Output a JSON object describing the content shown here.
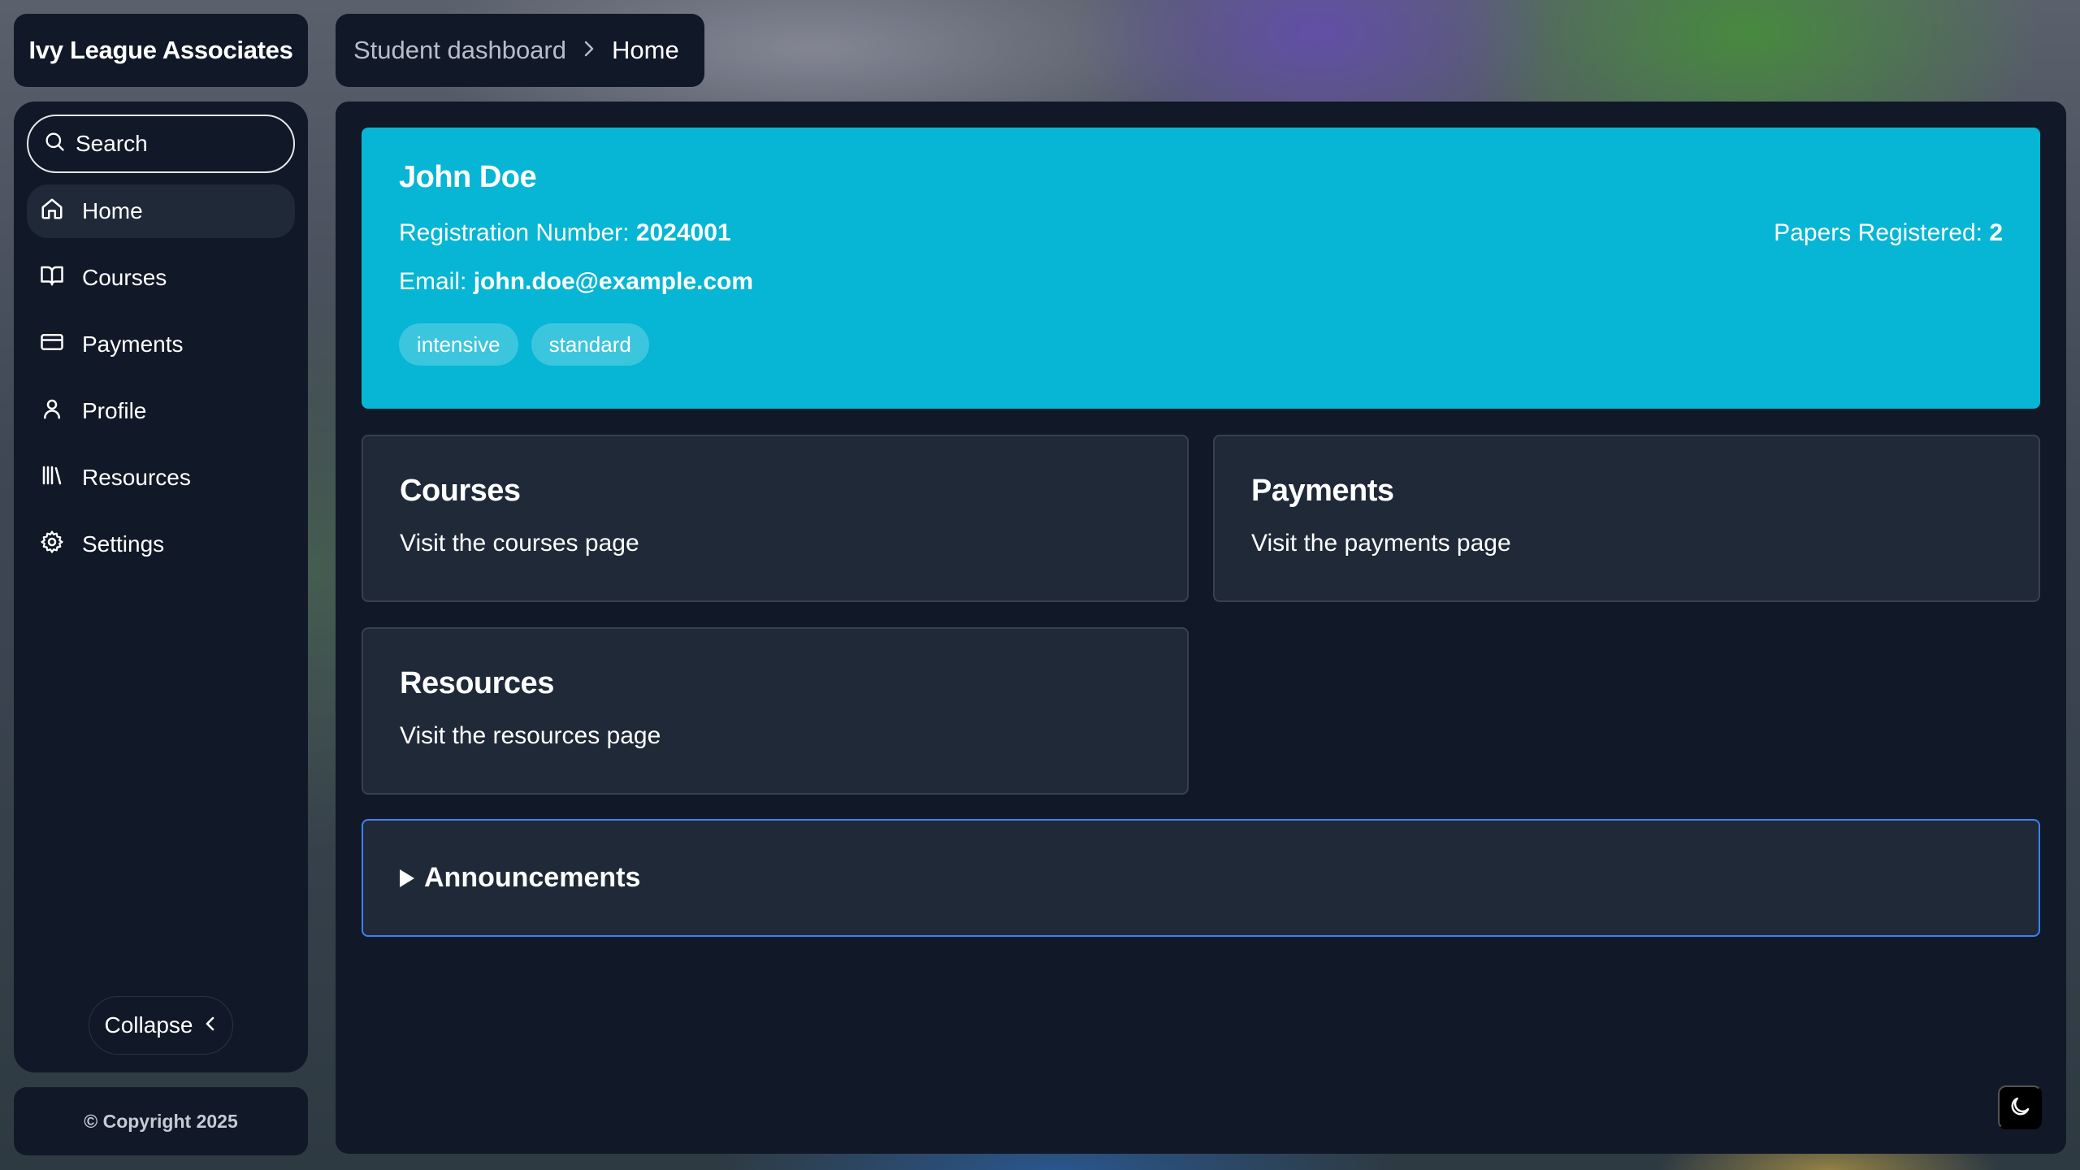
{
  "app": {
    "brand": "Ivy League Associates"
  },
  "breadcrumb": {
    "parent": "Student dashboard",
    "current": "Home"
  },
  "sidebar": {
    "search_placeholder": "Search",
    "items": [
      {
        "label": "Home",
        "icon": "home-icon",
        "active": true
      },
      {
        "label": "Courses",
        "icon": "book-open-icon",
        "active": false
      },
      {
        "label": "Payments",
        "icon": "credit-card-icon",
        "active": false
      },
      {
        "label": "Profile",
        "icon": "user-icon",
        "active": false
      },
      {
        "label": "Resources",
        "icon": "library-icon",
        "active": false
      },
      {
        "label": "Settings",
        "icon": "gear-icon",
        "active": false
      }
    ],
    "collapse_label": "Collapse"
  },
  "footer": {
    "copyright": "© Copyright 2025"
  },
  "student": {
    "name": "John Doe",
    "registration_label": "Registration Number:",
    "registration_number": "2024001",
    "email_label": "Email:",
    "email": "john.doe@example.com",
    "papers_label": "Papers Registered:",
    "papers_count": "2",
    "tags": [
      "intensive",
      "standard"
    ]
  },
  "cards": [
    {
      "title": "Courses",
      "description": "Visit the courses page"
    },
    {
      "title": "Payments",
      "description": "Visit the payments page"
    },
    {
      "title": "Resources",
      "description": "Visit the resources page"
    }
  ],
  "announcements": {
    "label": "Announcements"
  },
  "colors": {
    "panel": "#111827",
    "card": "#1f2937",
    "accent": "#06b6d4",
    "announce_border": "#3b82f6"
  }
}
